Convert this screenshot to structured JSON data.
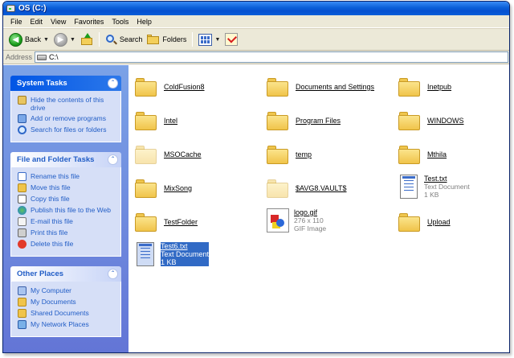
{
  "window": {
    "title": "OS (C:)"
  },
  "menu": [
    "File",
    "Edit",
    "View",
    "Favorites",
    "Tools",
    "Help"
  ],
  "toolbar": {
    "back_label": "Back",
    "search_label": "Search",
    "folders_label": "Folders"
  },
  "address": {
    "label": "Address",
    "value": "C:\\"
  },
  "sidebar": {
    "system_tasks": {
      "title": "System Tasks",
      "items": [
        {
          "label": "Hide the contents of this drive",
          "icon": "hide-contents-icon"
        },
        {
          "label": "Add or remove programs",
          "icon": "add-remove-programs-icon"
        },
        {
          "label": "Search for files or folders",
          "icon": "search-icon"
        }
      ]
    },
    "file_folder_tasks": {
      "title": "File and Folder Tasks",
      "items": [
        {
          "label": "Rename this file",
          "icon": "rename-icon"
        },
        {
          "label": "Move this file",
          "icon": "move-icon"
        },
        {
          "label": "Copy this file",
          "icon": "copy-icon"
        },
        {
          "label": "Publish this file to the Web",
          "icon": "globe-icon"
        },
        {
          "label": "E-mail this file",
          "icon": "email-icon"
        },
        {
          "label": "Print this file",
          "icon": "print-icon"
        },
        {
          "label": "Delete this file",
          "icon": "delete-icon"
        }
      ]
    },
    "other_places": {
      "title": "Other Places",
      "items": [
        {
          "label": "My Computer",
          "icon": "my-computer-icon"
        },
        {
          "label": "My Documents",
          "icon": "my-documents-icon"
        },
        {
          "label": "Shared Documents",
          "icon": "shared-documents-icon"
        },
        {
          "label": "My Network Places",
          "icon": "network-places-icon"
        }
      ]
    }
  },
  "files": [
    {
      "name": "ColdFusion8",
      "type": "folder"
    },
    {
      "name": "Documents and Settings",
      "type": "folder"
    },
    {
      "name": "Inetpub",
      "type": "folder"
    },
    {
      "name": "Intel",
      "type": "folder"
    },
    {
      "name": "Program Files",
      "type": "folder"
    },
    {
      "name": "WINDOWS",
      "type": "folder"
    },
    {
      "name": "MSOCache",
      "type": "folder-hidden"
    },
    {
      "name": "temp",
      "type": "folder"
    },
    {
      "name": "Mthila",
      "type": "folder"
    },
    {
      "name": "MixSong",
      "type": "folder"
    },
    {
      "name": "$AVG8.VAULT$",
      "type": "folder-hidden"
    },
    {
      "name": "Test.txt",
      "type": "text",
      "kind": "Text Document",
      "size": "1 KB"
    },
    {
      "name": "TestFolder",
      "type": "folder"
    },
    {
      "name": "logo.gif",
      "type": "image",
      "dims": "276 x 110",
      "kind": "GIF Image"
    },
    {
      "name": "Upload",
      "type": "folder"
    },
    {
      "name": "Test6.txt",
      "type": "text",
      "kind": "Text Document",
      "size": "1 KB",
      "selected": true
    }
  ]
}
